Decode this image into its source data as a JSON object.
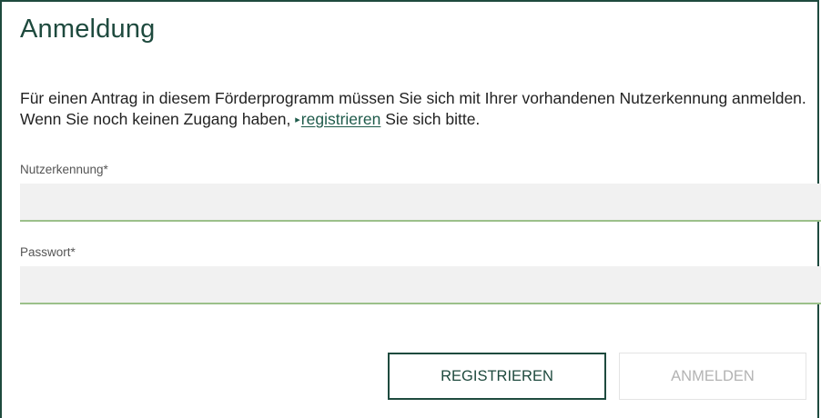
{
  "form": {
    "title": "Anmeldung",
    "intro_before_link": "Für einen Antrag in diesem Förderprogramm müssen Sie sich mit Ihrer vorhandenen Nutzerkennung anmelden. Wenn Sie noch keinen Zugang haben, ",
    "link_arrow": "▸",
    "link_label": "registrieren",
    "intro_after_link": " Sie sich bitte.",
    "username_label": "Nutzerkennung*",
    "username_value": "",
    "password_label": "Passwort*",
    "password_value": "",
    "register_button": "REGISTRIEREN",
    "login_button": "ANMELDEN"
  },
  "colors": {
    "brand_dark_green": "#1e4a3e",
    "input_underline_green": "#9bc08a",
    "input_background": "#f1f1f1",
    "disabled_text": "#b3b3b3"
  }
}
